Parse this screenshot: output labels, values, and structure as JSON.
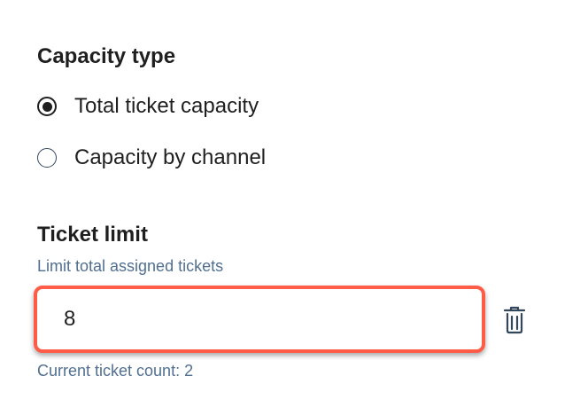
{
  "capacity": {
    "title": "Capacity type",
    "options": [
      {
        "label": "Total ticket capacity",
        "selected": true
      },
      {
        "label": "Capacity by channel",
        "selected": false
      }
    ]
  },
  "ticket_limit": {
    "title": "Ticket limit",
    "helper": "Limit total assigned tickets",
    "input_value": "8",
    "current_count": "Current ticket count: 2",
    "delete_icon": "trash-icon"
  },
  "colors": {
    "text": "#1f1f1f",
    "muted": "#516f90",
    "highlight_border": "#ff5c48"
  }
}
